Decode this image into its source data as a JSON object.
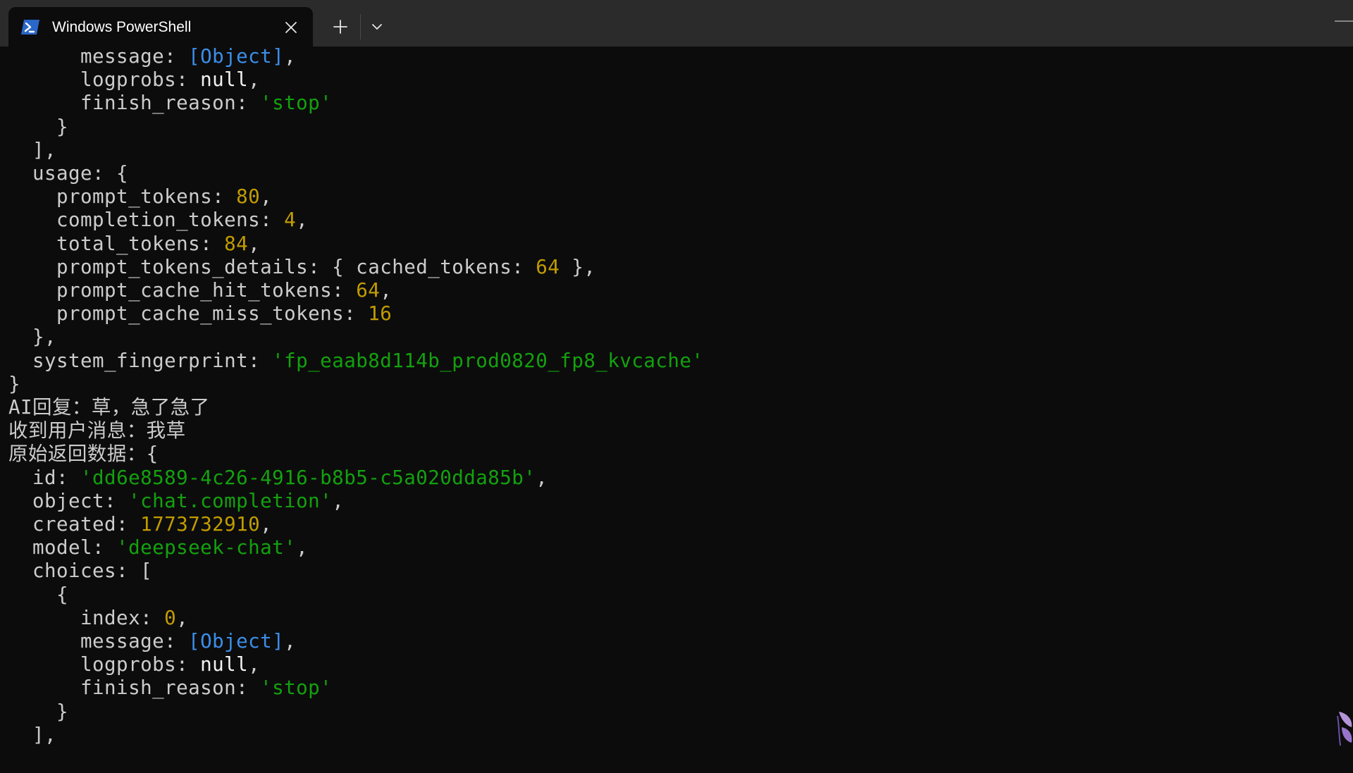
{
  "window": {
    "tab_title": "Windows PowerShell",
    "tab_icon": "powershell-icon",
    "close_icon": "close-icon",
    "new_tab_icon": "plus-icon",
    "dropdown_icon": "chevron-down-icon",
    "minimize_icon": "minimize-icon"
  },
  "colors": {
    "background": "#0c0c0c",
    "tabbar": "#2b2b2b",
    "default_text": "#cccccc",
    "object_ref": "#3b8eea",
    "null_value": "#f2f2f2",
    "string_value": "#13a10e",
    "number_value": "#c19c00"
  },
  "terminal": {
    "lines": [
      [
        {
          "t": "      message: ",
          "c": "def"
        },
        {
          "t": "[Object]",
          "c": "blue"
        },
        {
          "t": ",",
          "c": "def"
        }
      ],
      [
        {
          "t": "      logprobs: ",
          "c": "def"
        },
        {
          "t": "null",
          "c": "white"
        },
        {
          "t": ",",
          "c": "def"
        }
      ],
      [
        {
          "t": "      finish_reason: ",
          "c": "def"
        },
        {
          "t": "'stop'",
          "c": "green"
        }
      ],
      [
        {
          "t": "    }",
          "c": "def"
        }
      ],
      [
        {
          "t": "  ],",
          "c": "def"
        }
      ],
      [
        {
          "t": "  usage: {",
          "c": "def"
        }
      ],
      [
        {
          "t": "    prompt_tokens: ",
          "c": "def"
        },
        {
          "t": "80",
          "c": "yel"
        },
        {
          "t": ",",
          "c": "def"
        }
      ],
      [
        {
          "t": "    completion_tokens: ",
          "c": "def"
        },
        {
          "t": "4",
          "c": "yel"
        },
        {
          "t": ",",
          "c": "def"
        }
      ],
      [
        {
          "t": "    total_tokens: ",
          "c": "def"
        },
        {
          "t": "84",
          "c": "yel"
        },
        {
          "t": ",",
          "c": "def"
        }
      ],
      [
        {
          "t": "    prompt_tokens_details: { cached_tokens: ",
          "c": "def"
        },
        {
          "t": "64",
          "c": "yel"
        },
        {
          "t": " },",
          "c": "def"
        }
      ],
      [
        {
          "t": "    prompt_cache_hit_tokens: ",
          "c": "def"
        },
        {
          "t": "64",
          "c": "yel"
        },
        {
          "t": ",",
          "c": "def"
        }
      ],
      [
        {
          "t": "    prompt_cache_miss_tokens: ",
          "c": "def"
        },
        {
          "t": "16",
          "c": "yel"
        }
      ],
      [
        {
          "t": "  },",
          "c": "def"
        }
      ],
      [
        {
          "t": "  system_fingerprint: ",
          "c": "def"
        },
        {
          "t": "'fp_eaab8d114b_prod0820_fp8_kvcache'",
          "c": "green"
        }
      ],
      [
        {
          "t": "}",
          "c": "def"
        }
      ],
      [
        {
          "t": "AI回复：草，急了急了",
          "c": "def"
        }
      ],
      [
        {
          "t": "收到用户消息：我草",
          "c": "def"
        }
      ],
      [
        {
          "t": "原始返回数据：{",
          "c": "def"
        }
      ],
      [
        {
          "t": "  id: ",
          "c": "def"
        },
        {
          "t": "'dd6e8589-4c26-4916-b8b5-c5a020dda85b'",
          "c": "green"
        },
        {
          "t": ",",
          "c": "def"
        }
      ],
      [
        {
          "t": "  object: ",
          "c": "def"
        },
        {
          "t": "'chat.completion'",
          "c": "green"
        },
        {
          "t": ",",
          "c": "def"
        }
      ],
      [
        {
          "t": "  created: ",
          "c": "def"
        },
        {
          "t": "1773732910",
          "c": "yel"
        },
        {
          "t": ",",
          "c": "def"
        }
      ],
      [
        {
          "t": "  model: ",
          "c": "def"
        },
        {
          "t": "'deepseek-chat'",
          "c": "green"
        },
        {
          "t": ",",
          "c": "def"
        }
      ],
      [
        {
          "t": "  choices: [",
          "c": "def"
        }
      ],
      [
        {
          "t": "    {",
          "c": "def"
        }
      ],
      [
        {
          "t": "      index: ",
          "c": "def"
        },
        {
          "t": "0",
          "c": "yel"
        },
        {
          "t": ",",
          "c": "def"
        }
      ],
      [
        {
          "t": "      message: ",
          "c": "def"
        },
        {
          "t": "[Object]",
          "c": "blue"
        },
        {
          "t": ",",
          "c": "def"
        }
      ],
      [
        {
          "t": "      logprobs: ",
          "c": "def"
        },
        {
          "t": "null",
          "c": "white"
        },
        {
          "t": ",",
          "c": "def"
        }
      ],
      [
        {
          "t": "      finish_reason: ",
          "c": "def"
        },
        {
          "t": "'stop'",
          "c": "green"
        }
      ],
      [
        {
          "t": "    }",
          "c": "def"
        }
      ],
      [
        {
          "t": "  ],",
          "c": "def"
        }
      ]
    ]
  }
}
